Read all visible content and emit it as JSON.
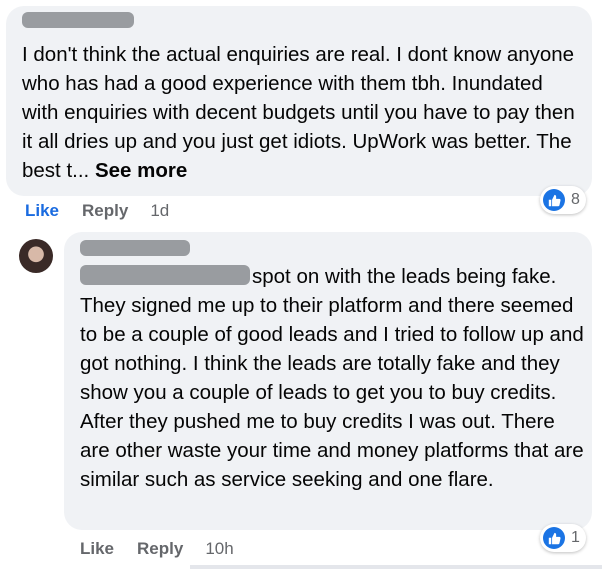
{
  "comment1": {
    "text": "I don't think the actual enquiries are real. I dont know anyone who has had a good experience with them tbh. Inundated with enquiries with decent budgets until you have to pay then it all dries up and you just get idiots. UpWork was better. The best t...",
    "see_more": "See more",
    "like_label": "Like",
    "reply_label": "Reply",
    "time": "1d",
    "reaction_count": "8"
  },
  "comment2": {
    "text": "spot on with the leads being fake. They signed me up to their platform and there seemed to be a couple of good leads and I tried to follow up and got nothing. I think the leads are totally fake and they show you a couple of leads to get you to buy credits. After they pushed me to buy credits I was out. There are other waste your time and money platforms that are similar such as service seeking and one flare.",
    "like_label": "Like",
    "reply_label": "Reply",
    "time": "10h",
    "reaction_count": "1"
  },
  "colors": {
    "accent": "#1b74e4",
    "bubble": "#f0f2f5",
    "meta": "#65676b"
  },
  "icons": [
    "like-thumb-icon",
    "avatar"
  ]
}
